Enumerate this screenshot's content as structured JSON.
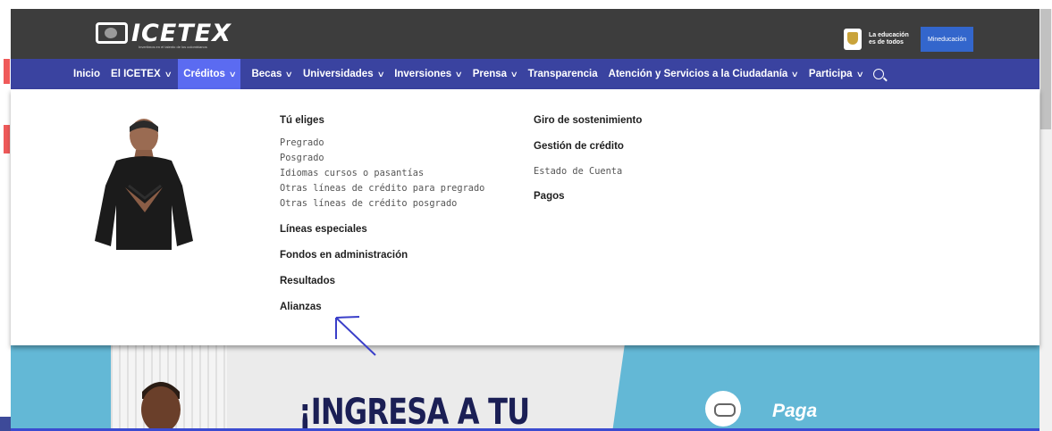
{
  "header": {
    "logo_text": "ICETEX",
    "logo_tagline": "Invertimos en el talento de los colombianos",
    "gov_text": "La educación es de todos",
    "gov_button": "Mineducación"
  },
  "nav": {
    "items": [
      {
        "label": "Inicio",
        "has_dropdown": false
      },
      {
        "label": "El ICETEX",
        "has_dropdown": true
      },
      {
        "label": "Créditos",
        "has_dropdown": true,
        "active": true
      },
      {
        "label": "Becas",
        "has_dropdown": true
      },
      {
        "label": "Universidades",
        "has_dropdown": true
      },
      {
        "label": "Inversiones",
        "has_dropdown": true
      },
      {
        "label": "Prensa",
        "has_dropdown": true
      },
      {
        "label": "Transparencia",
        "has_dropdown": false
      },
      {
        "label": "Atención y Servicios a la Ciudadanía",
        "has_dropdown": true
      },
      {
        "label": "Participa",
        "has_dropdown": true
      }
    ],
    "chevron": "∨",
    "search_icon": "search-icon"
  },
  "mega_menu": {
    "col1": {
      "tu_eliges": "Tú eliges",
      "tu_eliges_items": [
        "Pregrado",
        "Posgrado",
        "Idiomas cursos o pasantías",
        "Otras líneas de crédito para pregrado",
        "Otras líneas de crédito posgrado"
      ],
      "lineas_especiales": "Líneas especiales",
      "fondos": "Fondos en administración",
      "resultados": "Resultados",
      "alianzas": "Alianzas"
    },
    "col2": {
      "giro": "Giro de sostenimiento",
      "gestion": "Gestión de crédito",
      "estado_cuenta": "Estado de Cuenta",
      "pagos": "Pagos"
    }
  },
  "banner": {
    "title": "¡INGRESA A TU",
    "pay_label": "Paga"
  },
  "colors": {
    "topbar": "#3d3d3d",
    "navbar": "#3a43a0",
    "nav_active": "#5b6bf1",
    "banner": "#63b8d6",
    "annotation_arrow": "#3a3fc9"
  }
}
